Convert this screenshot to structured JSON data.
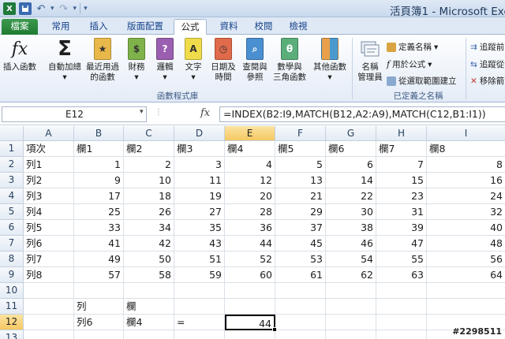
{
  "app": {
    "title": "活頁簿1 - Microsoft Exc",
    "excel_logo": "X"
  },
  "tabs": [
    {
      "label": "檔案"
    },
    {
      "label": "常用"
    },
    {
      "label": "插入"
    },
    {
      "label": "版面配置"
    },
    {
      "label": "公式"
    },
    {
      "label": "資料"
    },
    {
      "label": "校閱"
    },
    {
      "label": "檢視"
    }
  ],
  "active_tab": "公式",
  "ribbon": {
    "insert_function": {
      "line1": "插入函數",
      "line2": "",
      "glyph": "fx"
    },
    "autosum": {
      "line1": "自動加總",
      "line2": "",
      "glyph": "Σ"
    },
    "recent": {
      "line1": "最近用過",
      "line2": "的函數"
    },
    "financial": {
      "line1": "財務",
      "line2": ""
    },
    "logical": {
      "line1": "邏輯",
      "line2": "",
      "glyph": "?"
    },
    "text": {
      "line1": "文字",
      "line2": "",
      "glyph": "A"
    },
    "datetime": {
      "line1": "日期及",
      "line2": "時間"
    },
    "lookup": {
      "line1": "查閱與",
      "line2": "參照"
    },
    "math": {
      "line1": "數學與",
      "line2": "三角函數",
      "glyph": "θ"
    },
    "more": {
      "line1": "其他函數",
      "line2": ""
    },
    "group_function_library": "函數程式庫",
    "name_manager": {
      "line1": "名稱",
      "line2": "管理員"
    },
    "define_name": "定義名稱",
    "use_in_formula": "用於公式",
    "create_from_selection": "從選取範圍建立",
    "group_defined_names": "已定義之名稱",
    "trace_precedents": "追蹤前",
    "trace_dependents": "追蹤從",
    "remove_arrows": "移除箭"
  },
  "formula_bar": {
    "name_box": "E12",
    "fx": "fx",
    "formula": "=INDEX(B2:I9,MATCH(B12,A2:A9),MATCH(C12,B1:I1))"
  },
  "sheet": {
    "columns": [
      "A",
      "B",
      "C",
      "D",
      "E",
      "F",
      "G",
      "H",
      "I"
    ],
    "rows": [
      "1",
      "2",
      "3",
      "4",
      "5",
      "6",
      "7",
      "8",
      "9",
      "10",
      "11",
      "12",
      "13"
    ],
    "header_row": [
      "項次",
      "欄1",
      "欄2",
      "欄3",
      "欄4",
      "欄5",
      "欄6",
      "欄7",
      "欄8"
    ],
    "data_rows": [
      {
        "label": "列1",
        "values": [
          "1",
          "2",
          "3",
          "4",
          "5",
          "6",
          "7",
          "8"
        ]
      },
      {
        "label": "列2",
        "values": [
          "9",
          "10",
          "11",
          "12",
          "13",
          "14",
          "15",
          "16"
        ]
      },
      {
        "label": "列3",
        "values": [
          "17",
          "18",
          "19",
          "20",
          "21",
          "22",
          "23",
          "24"
        ]
      },
      {
        "label": "列4",
        "values": [
          "25",
          "26",
          "27",
          "28",
          "29",
          "30",
          "31",
          "32"
        ]
      },
      {
        "label": "列5",
        "values": [
          "33",
          "34",
          "35",
          "36",
          "37",
          "38",
          "39",
          "40"
        ]
      },
      {
        "label": "列6",
        "values": [
          "41",
          "42",
          "43",
          "44",
          "45",
          "46",
          "47",
          "48"
        ]
      },
      {
        "label": "列7",
        "values": [
          "49",
          "50",
          "51",
          "52",
          "53",
          "54",
          "55",
          "56"
        ]
      },
      {
        "label": "列8",
        "values": [
          "57",
          "58",
          "59",
          "60",
          "61",
          "62",
          "63",
          "64"
        ]
      }
    ],
    "row11": {
      "b": "列",
      "c": "欄"
    },
    "row12": {
      "b": "列6",
      "c": "欄4",
      "d": "=",
      "e": "44"
    },
    "active_cell": "E12"
  },
  "watermark": "#2298511",
  "colors": {
    "file_tab": "#1f7a32",
    "tab_text": "#15428b",
    "header_selected": "#f5c863"
  }
}
